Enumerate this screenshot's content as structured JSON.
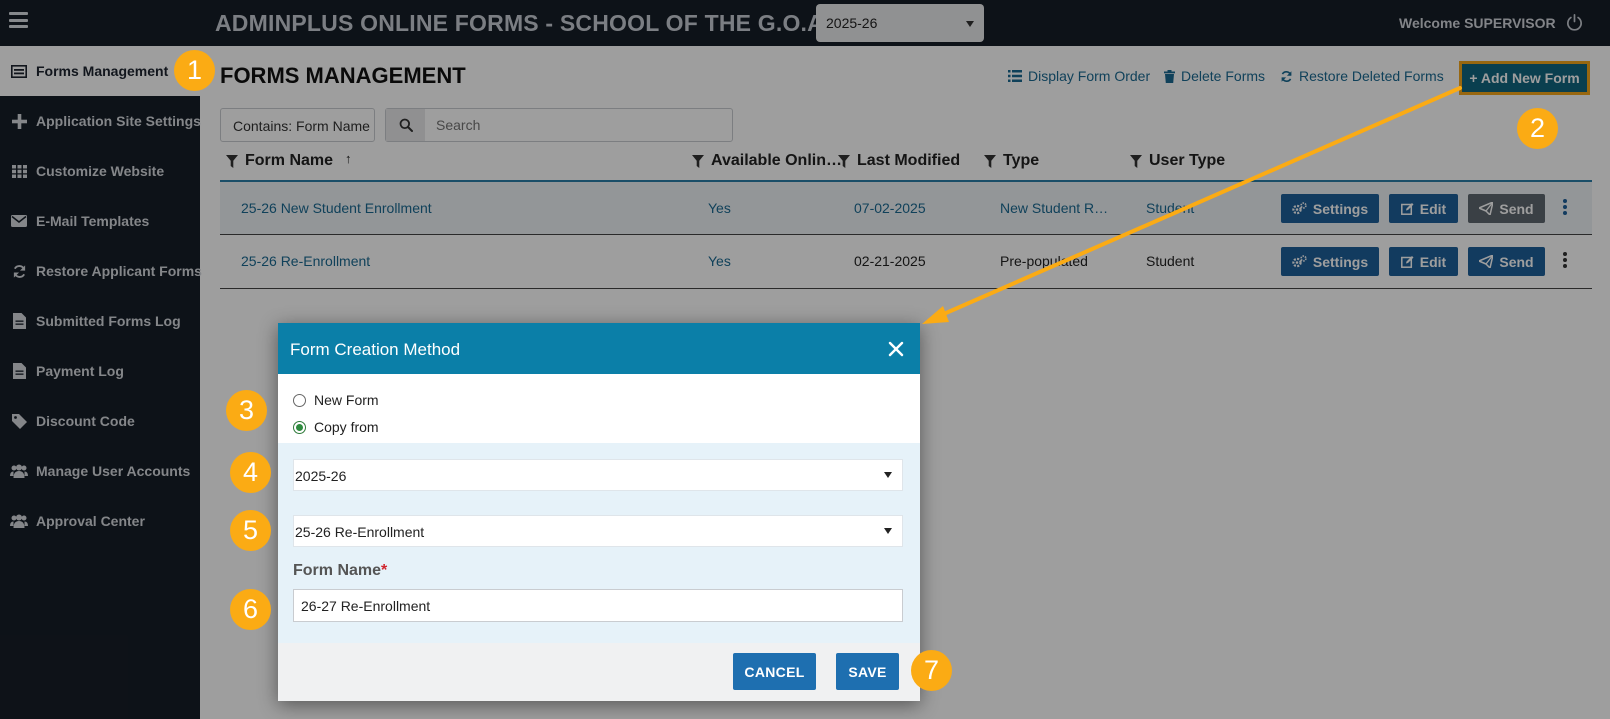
{
  "app": {
    "title": "ADMINPLUS ONLINE FORMS - SCHOOL OF THE G.O.A.T.",
    "year_selected": "2025-26",
    "welcome": "Welcome SUPERVISOR"
  },
  "sidebar": {
    "items": [
      {
        "label": "Forms Management",
        "icon": "forms-icon"
      },
      {
        "label": "Application Site Settings",
        "icon": "plus-icon"
      },
      {
        "label": "Customize Website",
        "icon": "grid-icon"
      },
      {
        "label": "E-Mail Templates",
        "icon": "envelope-icon"
      },
      {
        "label": "Restore Applicant Forms",
        "icon": "refresh-icon"
      },
      {
        "label": "Submitted Forms Log",
        "icon": "file-icon"
      },
      {
        "label": "Payment Log",
        "icon": "file-icon"
      },
      {
        "label": "Discount Code",
        "icon": "tag-icon"
      },
      {
        "label": "Manage User Accounts",
        "icon": "users-icon"
      },
      {
        "label": "Approval Center",
        "icon": "users-icon"
      }
    ]
  },
  "main": {
    "page_title": "FORMS MANAGEMENT",
    "actions": {
      "display_order": "Display Form Order",
      "delete_forms": "Delete Forms",
      "restore_deleted": "Restore Deleted Forms",
      "add_new": "+ Add New Form"
    },
    "filter": {
      "contains": "Contains: Form Name",
      "search_placeholder": "Search"
    },
    "columns": {
      "form_name": "Form Name",
      "sort_indicator": "↑",
      "available_online": "Available Onlin…",
      "last_modified": "Last Modified",
      "type": "Type",
      "user_type": "User Type"
    },
    "rows": [
      {
        "form_name": "25-26 New Student Enrollment",
        "available": "Yes",
        "modified": "07-02-2025",
        "type": "New Student R…",
        "user_type": "Student"
      },
      {
        "form_name": "25-26 Re-Enrollment",
        "available": "Yes",
        "modified": "02-21-2025",
        "type": "Pre-populated",
        "user_type": "Student"
      }
    ],
    "row_buttons": {
      "settings": "Settings",
      "edit": "Edit",
      "send": "Send"
    }
  },
  "modal": {
    "title": "Form Creation Method",
    "option_new": "New Form",
    "option_copy": "Copy from",
    "selected_option": "Copy from",
    "year_value": "2025-26",
    "source_form_value": "25-26 Re-Enrollment",
    "form_name_label": "Form Name",
    "required_mark": "*",
    "form_name_value": "26-27 Re-Enrollment",
    "cancel": "CANCEL",
    "save": "SAVE"
  },
  "callouts": [
    "1",
    "2",
    "3",
    "4",
    "5",
    "6",
    "7"
  ],
  "colors": {
    "accent": "#0b7fa8",
    "callout": "#fbab14",
    "button": "#1e6fb0",
    "sidebar": "#161d27"
  }
}
